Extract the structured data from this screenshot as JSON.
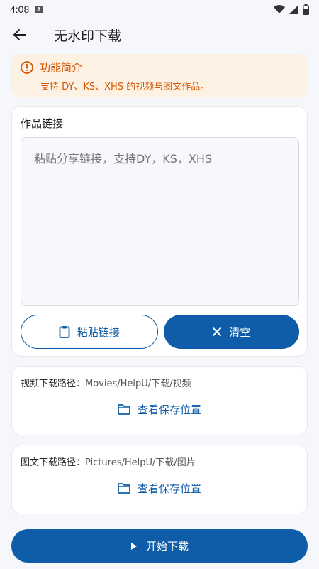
{
  "status_bar": {
    "time": "4:08",
    "notification_icon": "a-icon"
  },
  "app_bar": {
    "title": "无水印下载",
    "back_icon": "arrow-left-icon"
  },
  "intro": {
    "title": "功能简介",
    "description": "支持 DY、KS、XHS 的视频与图文作品。",
    "icon": "info-circle-icon",
    "accent_color": "#d35400",
    "background_color": "#fdf1e3"
  },
  "link_section": {
    "label": "作品链接",
    "placeholder": "粘贴分享链接，支持DY，KS，XHS",
    "value": "",
    "paste_button": "粘贴链接",
    "clear_button": "清空"
  },
  "video_path": {
    "label": "视频下载路径：",
    "path": "Movies/HelpU/下载/视频",
    "view_button": "查看保存位置"
  },
  "image_path": {
    "label": "图文下载路径：",
    "path": "Pictures/HelpU/下载/图片",
    "view_button": "查看保存位置"
  },
  "start_button": {
    "label": "开始下载",
    "icon": "play-icon"
  },
  "colors": {
    "primary": "#0f5da8",
    "background": "#f5f7fb"
  }
}
